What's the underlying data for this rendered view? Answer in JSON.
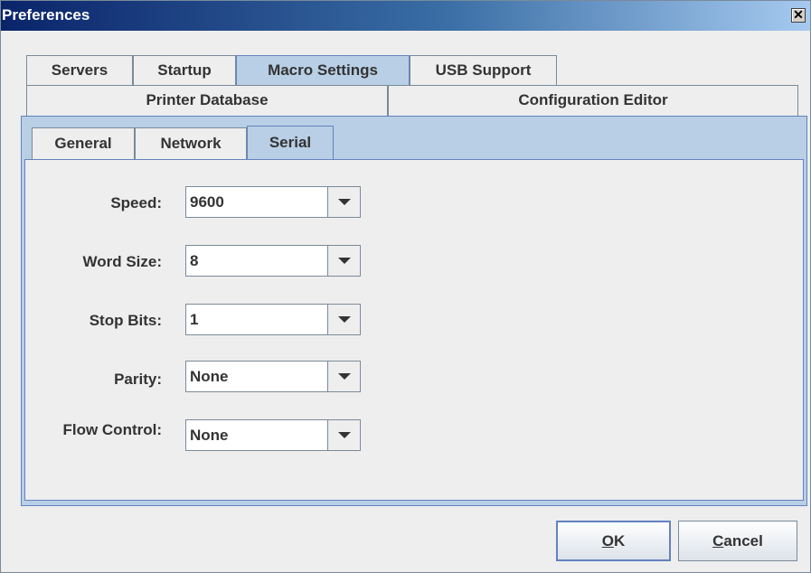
{
  "window": {
    "title": "Preferences",
    "close_glyph": "✕"
  },
  "outer_tabs": {
    "row1": [
      "Servers",
      "Startup",
      "Macro Settings",
      "USB Support"
    ],
    "row2": [
      "Printer Database",
      "Configuration Editor"
    ],
    "selected": "Macro Settings"
  },
  "inner_tabs": {
    "items": [
      "General",
      "Network",
      "Serial"
    ],
    "selected": "Serial"
  },
  "serial": {
    "speed": {
      "label": "Speed:",
      "value": "9600"
    },
    "word_size": {
      "label": "Word Size:",
      "value": "8"
    },
    "stop_bits": {
      "label": "Stop Bits:",
      "value": "1"
    },
    "parity": {
      "label": "Parity:",
      "value": "None"
    },
    "flow_control": {
      "label": "Flow Control:",
      "value": "None"
    }
  },
  "buttons": {
    "ok": {
      "mnemonic": "O",
      "rest": "K"
    },
    "cancel": {
      "mnemonic": "C",
      "rest": "ancel"
    }
  },
  "icons": {
    "dropdown": "chevron-down-icon",
    "close": "close-icon"
  },
  "colors": {
    "title_gradient_start": "#0a246a",
    "tab_selected": "#b8cfe5",
    "border_accent": "#6382bf"
  }
}
